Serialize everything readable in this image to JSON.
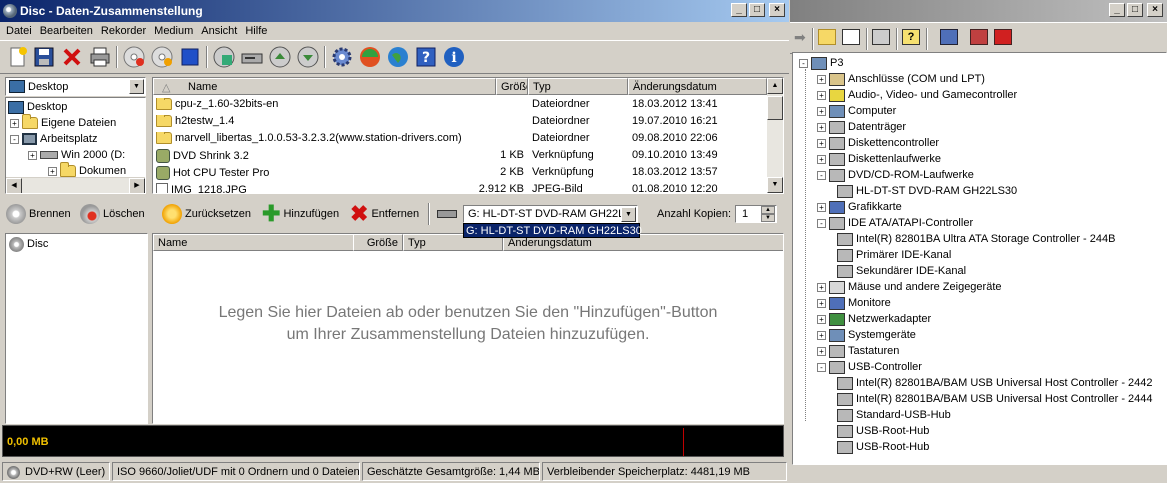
{
  "burn_window": {
    "title": "Disc - Daten-Zusammenstellung",
    "menu": [
      "Datei",
      "Bearbeiten",
      "Rekorder",
      "Medium",
      "Ansicht",
      "Hilfe"
    ],
    "tree_combo_value": "Desktop",
    "tree": [
      {
        "label": "Desktop",
        "level": 0,
        "toggle": ""
      },
      {
        "label": "Eigene Dateien",
        "level": 1,
        "toggle": "+"
      },
      {
        "label": "Arbeitsplatz",
        "level": 1,
        "toggle": "-"
      },
      {
        "label": "Win 2000 (D:",
        "level": 2,
        "toggle": "+"
      },
      {
        "label": "Dokumen",
        "level": 3,
        "toggle": "+"
      }
    ],
    "file_columns": [
      "Name",
      "Größe",
      "Typ",
      "Änderungsdatum"
    ],
    "files": [
      {
        "name": "cpu-z_1.60-32bits-en",
        "size": "",
        "type": "Dateiordner",
        "date": "18.03.2012 13:41",
        "icon": "folder"
      },
      {
        "name": "h2testw_1.4",
        "size": "",
        "type": "Dateiordner",
        "date": "19.07.2010 16:21",
        "icon": "folder"
      },
      {
        "name": "marvell_libertas_1.0.0.53-3.2.3.2(www.station-drivers.com)",
        "size": "",
        "type": "Dateiordner",
        "date": "09.08.2010 22:06",
        "icon": "folder"
      },
      {
        "name": "DVD Shrink 3.2",
        "size": "1 KB",
        "type": "Verknüpfung",
        "date": "09.10.2010 13:49",
        "icon": "shortcut"
      },
      {
        "name": "Hot CPU Tester Pro",
        "size": "2 KB",
        "type": "Verknüpfung",
        "date": "18.03.2012 13:57",
        "icon": "shortcut"
      },
      {
        "name": "IMG_1218.JPG",
        "size": "2.912 KB",
        "type": "JPEG-Bild",
        "date": "01.08.2010 12:20",
        "icon": "file"
      }
    ],
    "actions": {
      "burn": "Brennen",
      "delete": "Löschen",
      "reset": "Zurücksetzen",
      "add": "Hinzufügen",
      "remove": "Entfernen"
    },
    "drive_combo_value": "G: HL-DT-ST DVD-RAM GH22L",
    "drive_popup_option": "G: HL-DT-ST DVD-RAM GH22LS30",
    "copies_label": "Anzahl Kopien:",
    "copies_value": "1",
    "disc_tree_root": "Disc",
    "disc_columns": [
      "Name",
      "Größe",
      "Typ",
      "Änderungsdatum"
    ],
    "hint_line1": "Legen Sie hier Dateien ab oder benutzen Sie den \"Hinzufügen\"-Button",
    "hint_line2": "um Ihrer Zusammenstellung Dateien hinzuzufügen.",
    "capacity_text": "0,00 MB",
    "status": {
      "media": "DVD+RW (Leer)",
      "format": "ISO 9660/Joliet/UDF mit 0 Ordnern und 0 Dateien",
      "total": "Geschätzte Gesamtgröße: 1,44 MB",
      "free": "Verbleibender Speicherplatz: 4481,19 MB"
    }
  },
  "device_manager": {
    "root": "P3",
    "items": [
      {
        "label": "Anschlüsse (COM und LPT)",
        "level": 1,
        "toggle": "+",
        "color": "#d9c48a"
      },
      {
        "label": "Audio-, Video- und Gamecontroller",
        "level": 1,
        "toggle": "+",
        "color": "#e8d640"
      },
      {
        "label": "Computer",
        "level": 1,
        "toggle": "+",
        "color": "#6f8fb8"
      },
      {
        "label": "Datenträger",
        "level": 1,
        "toggle": "+",
        "color": "#b8b8b8"
      },
      {
        "label": "Diskettencontroller",
        "level": 1,
        "toggle": "+",
        "color": "#b8b8b8"
      },
      {
        "label": "Diskettenlaufwerke",
        "level": 1,
        "toggle": "+",
        "color": "#b8b8b8"
      },
      {
        "label": "DVD/CD-ROM-Laufwerke",
        "level": 1,
        "toggle": "-",
        "color": "#b8b8b8"
      },
      {
        "label": "HL-DT-ST DVD-RAM GH22LS30",
        "level": 2,
        "toggle": "",
        "color": "#b8b8b8"
      },
      {
        "label": "Grafikkarte",
        "level": 1,
        "toggle": "+",
        "color": "#4f6fb8"
      },
      {
        "label": "IDE ATA/ATAPI-Controller",
        "level": 1,
        "toggle": "-",
        "color": "#b8b8b8"
      },
      {
        "label": "Intel(R) 82801BA Ultra ATA Storage Controller - 244B",
        "level": 2,
        "toggle": "",
        "color": "#b8b8b8"
      },
      {
        "label": "Primärer IDE-Kanal",
        "level": 2,
        "toggle": "",
        "color": "#b8b8b8"
      },
      {
        "label": "Sekundärer IDE-Kanal",
        "level": 2,
        "toggle": "",
        "color": "#b8b8b8"
      },
      {
        "label": "Mäuse und andere Zeigegeräte",
        "level": 1,
        "toggle": "+",
        "color": "#d8d8d8"
      },
      {
        "label": "Monitore",
        "level": 1,
        "toggle": "+",
        "color": "#4f6fb8"
      },
      {
        "label": "Netzwerkadapter",
        "level": 1,
        "toggle": "+",
        "color": "#3f8f3f"
      },
      {
        "label": "Systemgeräte",
        "level": 1,
        "toggle": "+",
        "color": "#6f8fb8"
      },
      {
        "label": "Tastaturen",
        "level": 1,
        "toggle": "+",
        "color": "#b8b8b8"
      },
      {
        "label": "USB-Controller",
        "level": 1,
        "toggle": "-",
        "color": "#b8b8b8"
      },
      {
        "label": "Intel(R) 82801BA/BAM USB Universal Host Controller - 2442",
        "level": 2,
        "toggle": "",
        "color": "#b8b8b8"
      },
      {
        "label": "Intel(R) 82801BA/BAM USB Universal Host Controller - 2444",
        "level": 2,
        "toggle": "",
        "color": "#b8b8b8"
      },
      {
        "label": "Standard-USB-Hub",
        "level": 2,
        "toggle": "",
        "color": "#b8b8b8"
      },
      {
        "label": "USB-Root-Hub",
        "level": 2,
        "toggle": "",
        "color": "#b8b8b8"
      },
      {
        "label": "USB-Root-Hub",
        "level": 2,
        "toggle": "",
        "color": "#b8b8b8"
      }
    ]
  }
}
